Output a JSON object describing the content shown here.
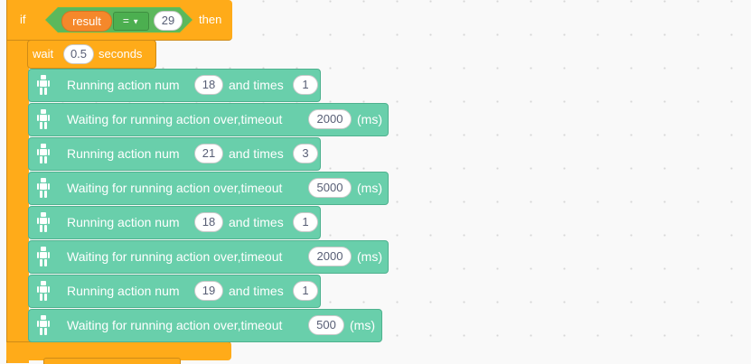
{
  "if_block": {
    "if_label": "if",
    "then_label": "then",
    "variable": "result",
    "operator": "=",
    "compare_value": "29"
  },
  "wait_block": {
    "label": "wait",
    "value": "0.5",
    "unit": "seconds"
  },
  "actions": [
    {
      "type": "run",
      "text1": "Running action num",
      "num": "18",
      "text2": "and times",
      "times": "1"
    },
    {
      "type": "wait",
      "text1": "Waiting for running action over,timeout",
      "timeout": "2000",
      "unit": "(ms)"
    },
    {
      "type": "run",
      "text1": "Running action num",
      "num": "21",
      "text2": "and times",
      "times": "3"
    },
    {
      "type": "wait",
      "text1": "Waiting for running action over,timeout",
      "timeout": "5000",
      "unit": "(ms)"
    },
    {
      "type": "run",
      "text1": "Running action num",
      "num": "18",
      "text2": "and times",
      "times": "1"
    },
    {
      "type": "wait",
      "text1": "Waiting for running action over,timeout",
      "timeout": "2000",
      "unit": "(ms)"
    },
    {
      "type": "run",
      "text1": "Running action num",
      "num": "19",
      "text2": "and times",
      "times": "1"
    },
    {
      "type": "wait",
      "text1": "Waiting for running action over,timeout",
      "timeout": "500",
      "unit": "(ms)"
    }
  ],
  "colors": {
    "control_orange": "#ffab19",
    "action_green": "#69cfab",
    "operator_green": "#59c059",
    "variable_orange": "#f5882b"
  },
  "icons": {
    "action_icon": "robot-icon"
  }
}
